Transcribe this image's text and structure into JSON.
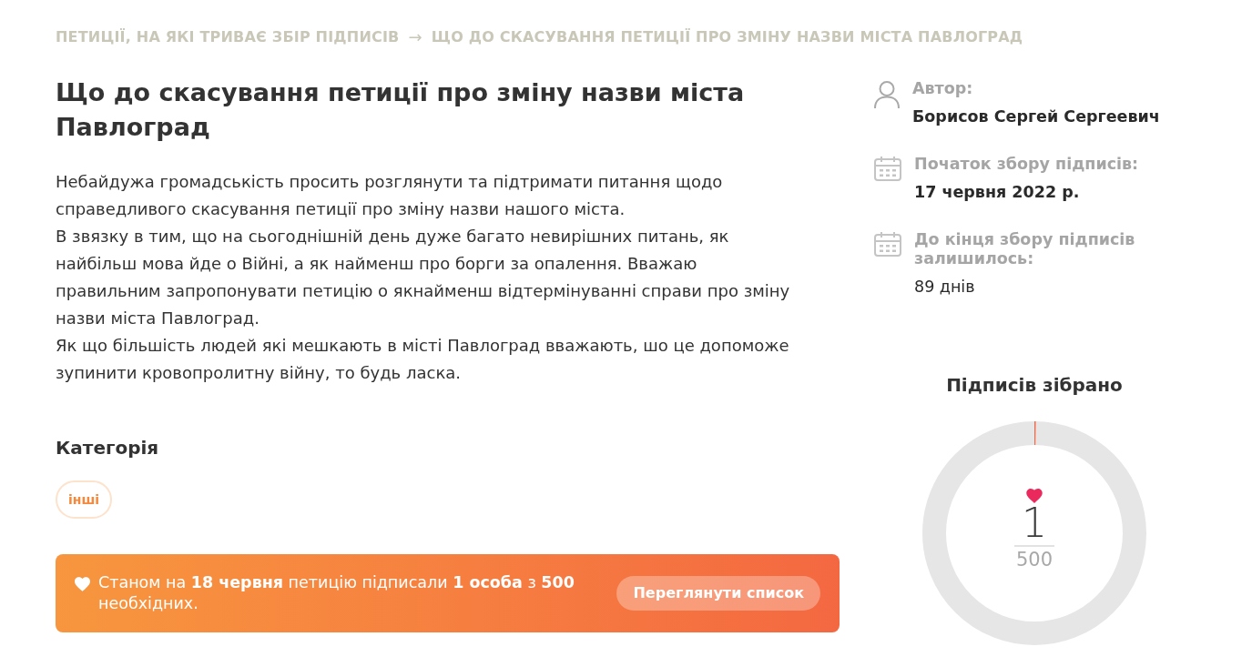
{
  "breadcrumb": {
    "items": [
      {
        "label": "ПЕТИЦІЇ, НА ЯКІ ТРИВАЄ ЗБІР ПІДПИСІВ"
      },
      {
        "label": "ЩО ДО СКАСУВАННЯ ПЕТИЦІЇ ПРО ЗМІНУ НАЗВИ МІСТА ПАВЛОГРАД"
      }
    ],
    "separator": "→"
  },
  "petition": {
    "title": "Що до скасування петиції про зміну назви міста Павлоград",
    "paragraphs": [
      "Небайдужа громадськість просить розглянути та підтримати питання щодо справедливого скасування петиції про зміну назви нашого міста.",
      "В звязку в тим, що на сьогоднішній день дуже багато невирішних питань, як найбільш мова йде о Війні, а як найменш про борги за опалення. Вважаю правильним запропонувати петицію о якнайменш відтермінуванні справи про зміну назви міста Павлоград.",
      "Як що більшість людей які мешкають в місті Павлоград вважають, шо це допоможе зупинити кровопролитну війну, то будь ласка."
    ],
    "category": {
      "heading": "Категорія",
      "tags": [
        "інші"
      ]
    },
    "signature_banner": {
      "text": "Станом на **18 червня** петицію підписали **1 особа** з **500** необхідних.",
      "button": "Переглянути список"
    }
  },
  "sidebar": {
    "details": [
      {
        "kind": "person",
        "label": "Автор:",
        "value": "Борисов Сергей Сергеевич",
        "bold": true
      },
      {
        "kind": "calendar",
        "label": "Початок збору підписів:",
        "value": "17 червня 2022 р.",
        "bold": true
      },
      {
        "kind": "calendar",
        "label": "До кінця збору підписів залишилось:",
        "value": "89 днів",
        "bold": false
      }
    ],
    "gauge": {
      "title": "Підписів зібрано",
      "count": "1",
      "goal": "500",
      "level": 0.002
    }
  }
}
